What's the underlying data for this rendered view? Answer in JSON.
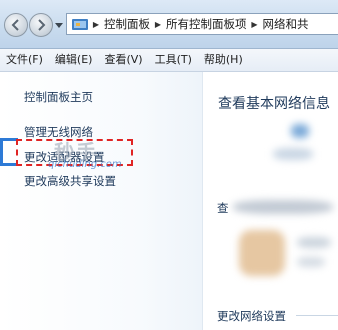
{
  "address_bar": {
    "breadcrumbs": [
      "控制面板",
      "所有控制面板项",
      "网络和共"
    ]
  },
  "menu": {
    "items": [
      "文件(F)",
      "编辑(E)",
      "查看(V)",
      "工具(T)",
      "帮助(H)"
    ]
  },
  "left_pane": {
    "links": [
      "控制面板主页",
      "管理无线网络",
      "更改适配器设置",
      "更改高级共享设置"
    ]
  },
  "watermark": {
    "big": "秒手",
    "small": "qichuding.com"
  },
  "main": {
    "title": "查看基本网络信息",
    "partial_char": "查",
    "section_label": "更改网络设置"
  },
  "colors": {
    "link": "#1e395b",
    "highlight": "#e02424",
    "pointer": "#2d7ad6"
  }
}
